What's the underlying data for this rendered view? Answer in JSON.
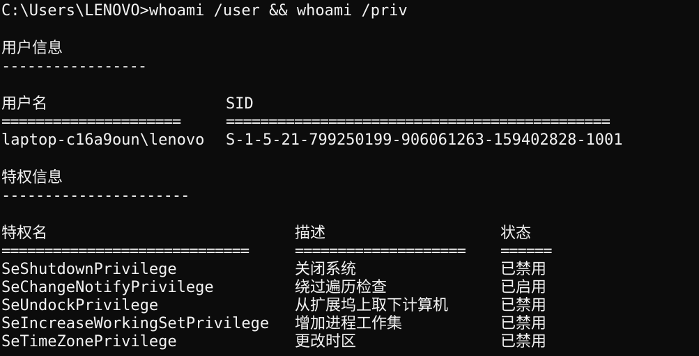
{
  "command_line": {
    "prompt": "C:\\Users\\LENOVO>",
    "command": "whoami /user && whoami /priv"
  },
  "user_info": {
    "title": "用户信息",
    "title_underline": "-----------------",
    "headers": {
      "username": "用户名",
      "sid": "SID"
    },
    "separators": {
      "username": "=====================",
      "sid": "============================================="
    },
    "row": {
      "username": "laptop-c16a9oun\\lenovo",
      "sid": "S-1-5-21-799250199-906061263-159402828-1001"
    }
  },
  "privilege_info": {
    "title": "特权信息",
    "title_underline": "----------------------",
    "headers": {
      "name": "特权名",
      "description": "描述",
      "state": "状态"
    },
    "separators": {
      "name": "=============================",
      "description": "====================",
      "state": "======"
    },
    "rows": [
      {
        "name": "SeShutdownPrivilege",
        "description": "关闭系统",
        "state": "已禁用"
      },
      {
        "name": "SeChangeNotifyPrivilege",
        "description": "绕过遍历检查",
        "state": "已启用"
      },
      {
        "name": "SeUndockPrivilege",
        "description": "从扩展坞上取下计算机",
        "state": "已禁用"
      },
      {
        "name": "SeIncreaseWorkingSetPrivilege",
        "description": "增加进程工作集",
        "state": "已禁用"
      },
      {
        "name": "SeTimeZonePrivilege",
        "description": "更改时区",
        "state": "已禁用"
      }
    ]
  }
}
